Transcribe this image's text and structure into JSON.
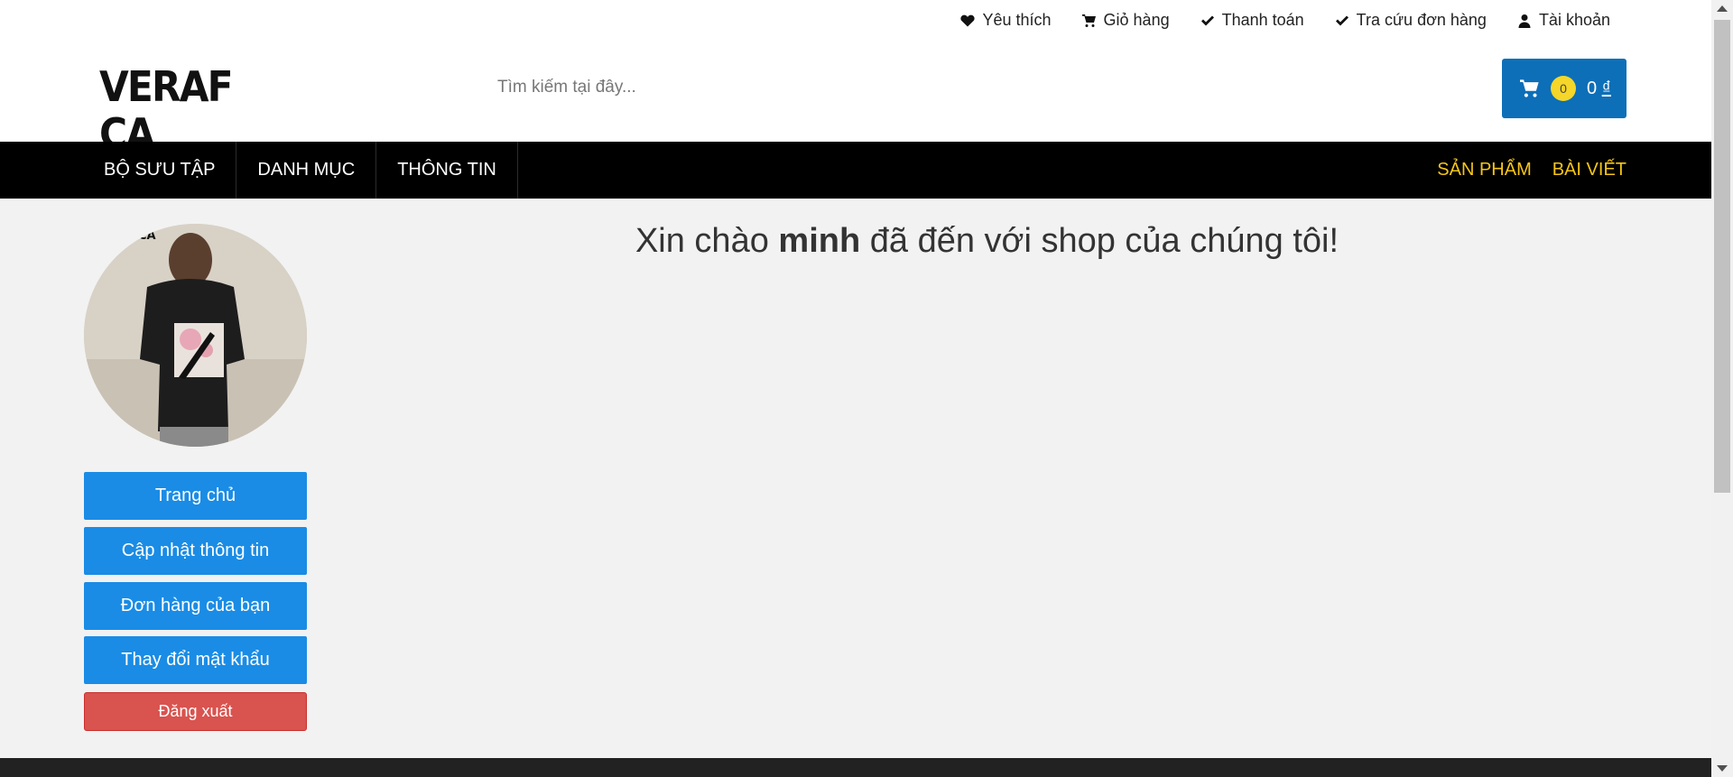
{
  "header": {
    "top_links": [
      {
        "label": "Yêu thích",
        "icon": "heart-icon"
      },
      {
        "label": "Giỏ hàng",
        "icon": "cart-icon"
      },
      {
        "label": "Thanh toán",
        "icon": "check-icon"
      },
      {
        "label": "Tra cứu đơn hàng",
        "icon": "check-icon"
      },
      {
        "label": "Tài khoản",
        "icon": "user-icon"
      }
    ],
    "logo_text": "VERAF CA",
    "search_placeholder": "Tìm kiếm tại đây...",
    "cart": {
      "count": "0",
      "total": "0",
      "currency": "₫"
    }
  },
  "nav": {
    "left": [
      "BỘ SƯU TẬP",
      "DANH MỤC",
      "THÔNG TIN"
    ],
    "right": [
      "SẢN PHẨM",
      "BÀI VIẾT"
    ]
  },
  "sidebar": {
    "avatar_text": "CA",
    "buttons": [
      "Trang chủ",
      "Cập nhật thông tin",
      "Đơn hàng của bạn",
      "Thay đổi mật khẩu"
    ],
    "logout": "Đăng xuất"
  },
  "welcome": {
    "prefix": "Xin chào",
    "username": "minh",
    "suffix": "đã đến với shop của chúng tôi!"
  },
  "colors": {
    "primary_blue": "#1a8ce5",
    "cart_blue": "#0d6fb8",
    "danger_red": "#d9534f",
    "nav_accent": "#f5c518",
    "cart_badge": "#f5d629"
  }
}
